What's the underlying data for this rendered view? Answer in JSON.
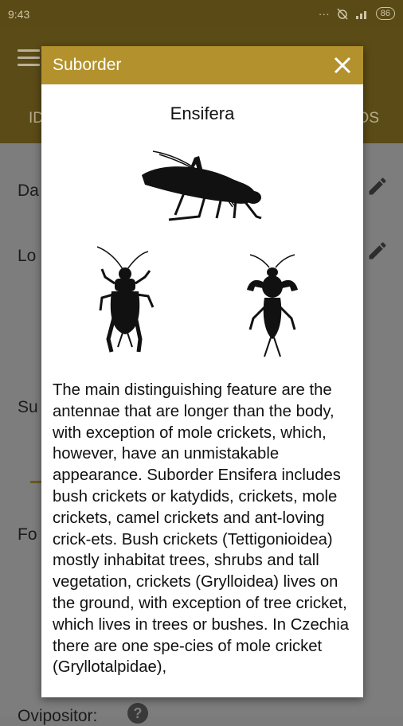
{
  "status_bar": {
    "time": "9:43",
    "battery": "86"
  },
  "background_app": {
    "tabs": {
      "left_fragment": "ID",
      "right_fragment": "OS"
    },
    "rows": [
      {
        "label_fragment": "Da"
      },
      {
        "label_fragment": "Lo"
      },
      {
        "label_fragment": "Su"
      },
      {
        "label_fragment": "Fo"
      },
      {
        "label_fragment": "Ovipositor:"
      }
    ]
  },
  "dialog": {
    "title": "Suborder",
    "suborder_name": "Ensifera",
    "images": [
      "bush-cricket-silhouette",
      "field-cricket-silhouette",
      "mole-cricket-silhouette"
    ],
    "description": "The main distinguishing feature are the antennae that are longer than the body, with exception of mole crickets, which, however, have an unmistakable appearance. Suborder Ensifera includes bush crickets or katydids, crickets, mole crickets, camel crickets and ant-loving crick-ets. Bush crickets (Tettigonioidea) mostly inhabitat trees, shrubs and tall vegetation, crickets (Grylloidea) lives on the ground, with exception of tree cricket, which lives in trees or bushes. In Czechia there are one spe-cies of mole cricket (Gryllotalpidae),"
  },
  "colors": {
    "dialog_header": "#b3922d",
    "app_bar_dimmed": "#5b4b17"
  }
}
